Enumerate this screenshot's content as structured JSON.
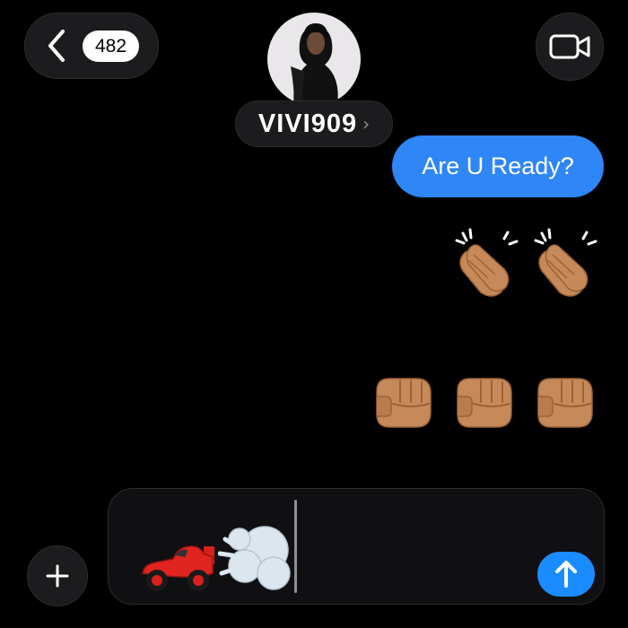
{
  "header": {
    "unread_count": "482",
    "contact_name": "VIVI909",
    "name_chevron": "›",
    "icons": {
      "back": "chevron-left-icon",
      "video": "video-camera-icon"
    }
  },
  "messages": [
    {
      "sender": "me",
      "type": "text",
      "text": "Are U Ready?"
    },
    {
      "sender": "me",
      "type": "emoji",
      "emoji": [
        "clapping-hands",
        "clapping-hands"
      ]
    },
    {
      "sender": "me",
      "type": "emoji",
      "emoji": [
        "oncoming-fist",
        "oncoming-fist",
        "oncoming-fist"
      ]
    }
  ],
  "composer": {
    "draft_emoji": [
      "racing-car",
      "dashing-away"
    ],
    "icons": {
      "plus": "plus-icon",
      "send": "arrow-up-icon"
    }
  },
  "colors": {
    "background": "#000000",
    "bubble_blue": "#2f86f6",
    "send_blue": "#1a8cff",
    "pill_gray": "#1c1c1e"
  }
}
